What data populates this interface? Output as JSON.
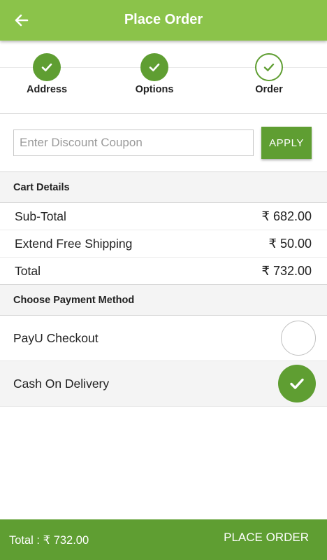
{
  "header": {
    "title": "Place Order",
    "back_icon": "arrow-left-icon"
  },
  "steps": [
    {
      "label": "Address",
      "state": "done"
    },
    {
      "label": "Options",
      "state": "done"
    },
    {
      "label": "Order",
      "state": "current"
    }
  ],
  "coupon": {
    "placeholder": "Enter Discount Coupon",
    "value": "",
    "apply_label": "APPLY"
  },
  "cart": {
    "heading": "Cart Details",
    "rows": [
      {
        "label": "Sub-Total",
        "amount": "₹ 682.00"
      },
      {
        "label": "Extend Free Shipping",
        "amount": "₹ 50.00"
      },
      {
        "label": "Total",
        "amount": "₹ 732.00"
      }
    ]
  },
  "payment": {
    "heading": "Choose Payment Method",
    "options": [
      {
        "label": "PayU Checkout",
        "selected": false
      },
      {
        "label": "Cash On Delivery",
        "selected": true
      }
    ]
  },
  "footer": {
    "total": "Total : ₹ 732.00",
    "place_order_label": "PLACE ORDER"
  },
  "colors": {
    "appbar": "#8bc34a",
    "accent": "#5f9e32"
  }
}
